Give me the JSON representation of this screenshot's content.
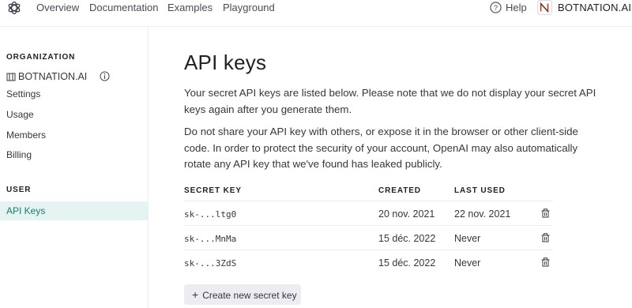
{
  "nav": {
    "links": [
      "Overview",
      "Documentation",
      "Examples",
      "Playground"
    ],
    "help": "Help",
    "org_name": "BOTNATION.AI"
  },
  "sidebar": {
    "org_heading": "ORGANIZATION",
    "org_name": "BOTNATION.AI",
    "org_items": [
      "Settings",
      "Usage",
      "Members",
      "Billing"
    ],
    "user_heading": "USER",
    "user_items": [
      "API Keys"
    ],
    "active_item": "API Keys"
  },
  "main": {
    "title": "API keys",
    "para1": "Your secret API keys are listed below. Please note that we do not display your secret API keys again after you generate them.",
    "para2": "Do not share your API key with others, or expose it in the browser or other client-side code. In order to protect the security of your account, OpenAI may also automatically rotate any API key that we've found has leaked publicly.",
    "table": {
      "headers": [
        "SECRET KEY",
        "CREATED",
        "LAST USED"
      ],
      "rows": [
        {
          "key": "sk-...ltg0",
          "created": "20 nov. 2021",
          "last_used": "22 nov. 2021"
        },
        {
          "key": "sk-...MnMa",
          "created": "15 déc. 2022",
          "last_used": "Never"
        },
        {
          "key": "sk-...3ZdS",
          "created": "15 déc. 2022",
          "last_used": "Never"
        }
      ]
    },
    "create_button": "Create new secret key"
  },
  "colors": {
    "active_bg": "#e6f3f3",
    "active_text": "#1a7f64",
    "button_bg": "#ececf1"
  }
}
